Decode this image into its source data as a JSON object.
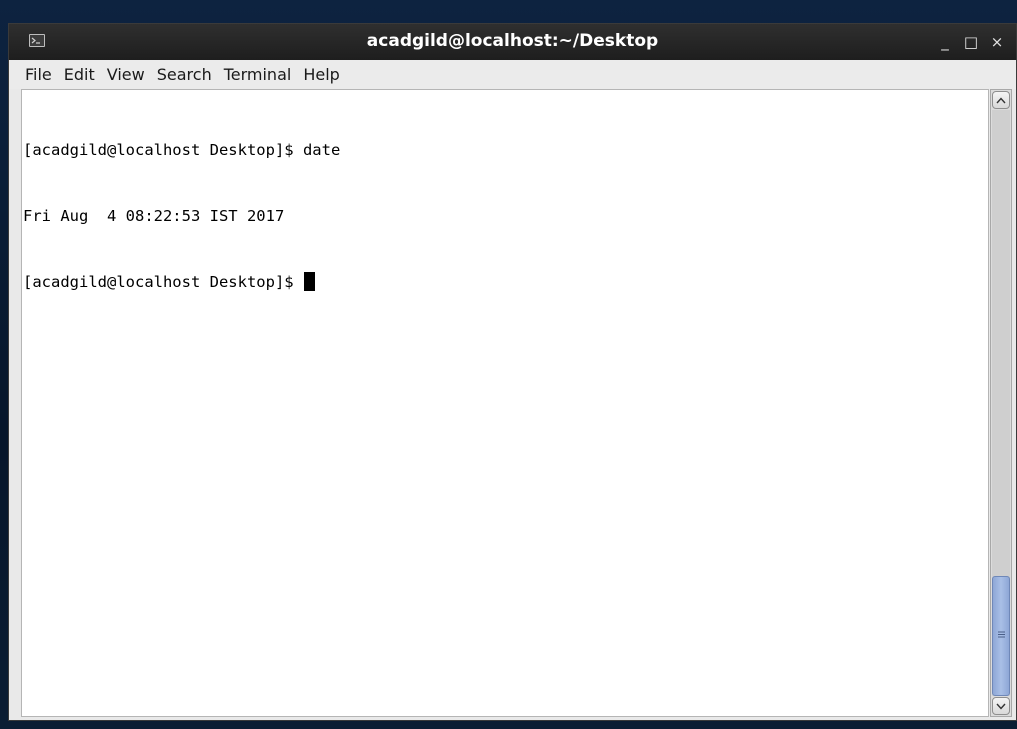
{
  "window": {
    "title": "acadgild@localhost:~/Desktop",
    "icon": "terminal-icon",
    "controls": {
      "minimize": "_",
      "maximize": "□",
      "close": "×"
    }
  },
  "menu": {
    "items": [
      "File",
      "Edit",
      "View",
      "Search",
      "Terminal",
      "Help"
    ]
  },
  "terminal": {
    "lines": [
      "[acadgild@localhost Desktop]$ date",
      "Fri Aug  4 08:22:53 IST 2017",
      "[acadgild@localhost Desktop]$ "
    ]
  },
  "colors": {
    "titlebar": "#1e1e1e",
    "terminal_bg": "#ffffff",
    "terminal_fg": "#000000",
    "scroll_thumb": "#a9bfe6"
  }
}
